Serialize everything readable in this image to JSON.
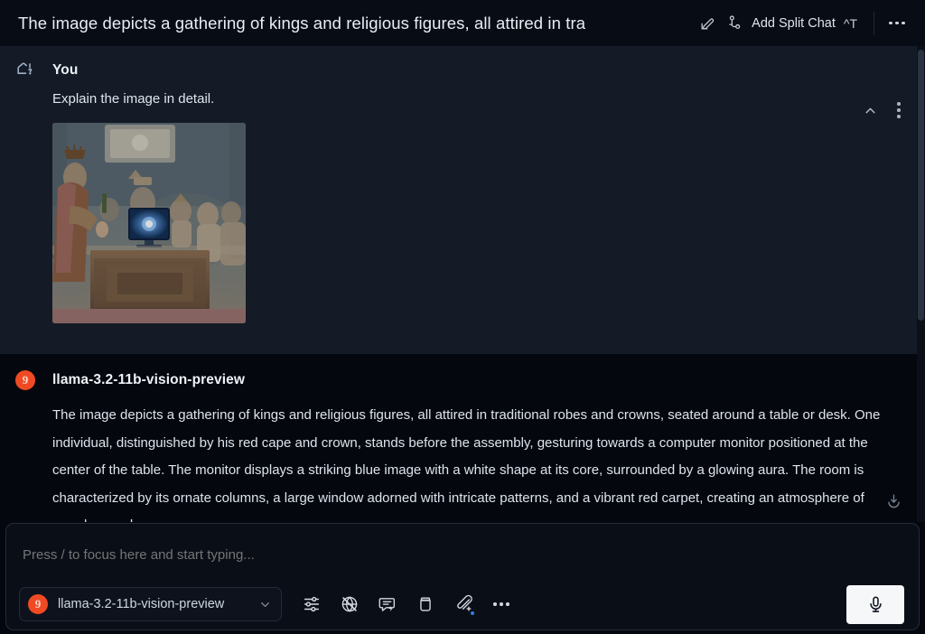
{
  "header": {
    "title": "The image depicts a gathering of kings and religious figures, all attired in tra",
    "edit_icon": "pencil-edit-icon",
    "split_icon": "branch-split-icon",
    "split_label": "Add Split Chat",
    "split_shortcut": "^T",
    "more_icon": "more-horizontal-icon"
  },
  "conversation": {
    "user": {
      "avatar_icon": "chat-question-icon",
      "role": "You",
      "text": "Explain the image in detail.",
      "attachment": {
        "name": "historical-assembly-image",
        "alt": "A gathering of robed kings and religious figures seated around an ornate wooden desk with a computer monitor displaying a blue glowing image"
      },
      "collapse_icon": "chevron-up-icon",
      "menu_icon": "more-vertical-icon"
    },
    "assistant": {
      "badge": "9",
      "badge_color": "#ef4a23",
      "model": "llama-3.2-11b-vision-preview",
      "text": "The image depicts a gathering of kings and religious figures, all attired in traditional robes and crowns, seated around a table or desk. One individual, distinguished by his red cape and crown, stands before the assembly, gesturing towards a computer monitor positioned at the center of the table. The monitor displays a striking blue image with a white shape at its core, surrounded by a glowing aura. The room is characterized by its ornate columns, a large window adorned with intricate patterns, and a vibrant red carpet, creating an atmosphere of grandeur and"
    },
    "scroll_down_icon": "scroll-to-bottom-icon"
  },
  "composer": {
    "placeholder": "Press / to focus here and start typing...",
    "value": "",
    "model_badge": "9",
    "model_name": "llama-3.2-11b-vision-preview",
    "dropdown_icon": "chevron-down-icon",
    "tools": [
      {
        "name": "settings-sliders-icon",
        "label": "Settings"
      },
      {
        "name": "globe-off-icon",
        "label": "Web search disabled"
      },
      {
        "name": "prompt-flash-icon",
        "label": "Quick prompt"
      },
      {
        "name": "container-icon",
        "label": "Container"
      },
      {
        "name": "attach-plus-icon",
        "label": "Attach file"
      },
      {
        "name": "more-horizontal-icon",
        "label": "More options"
      }
    ],
    "mic_icon": "microphone-icon"
  }
}
